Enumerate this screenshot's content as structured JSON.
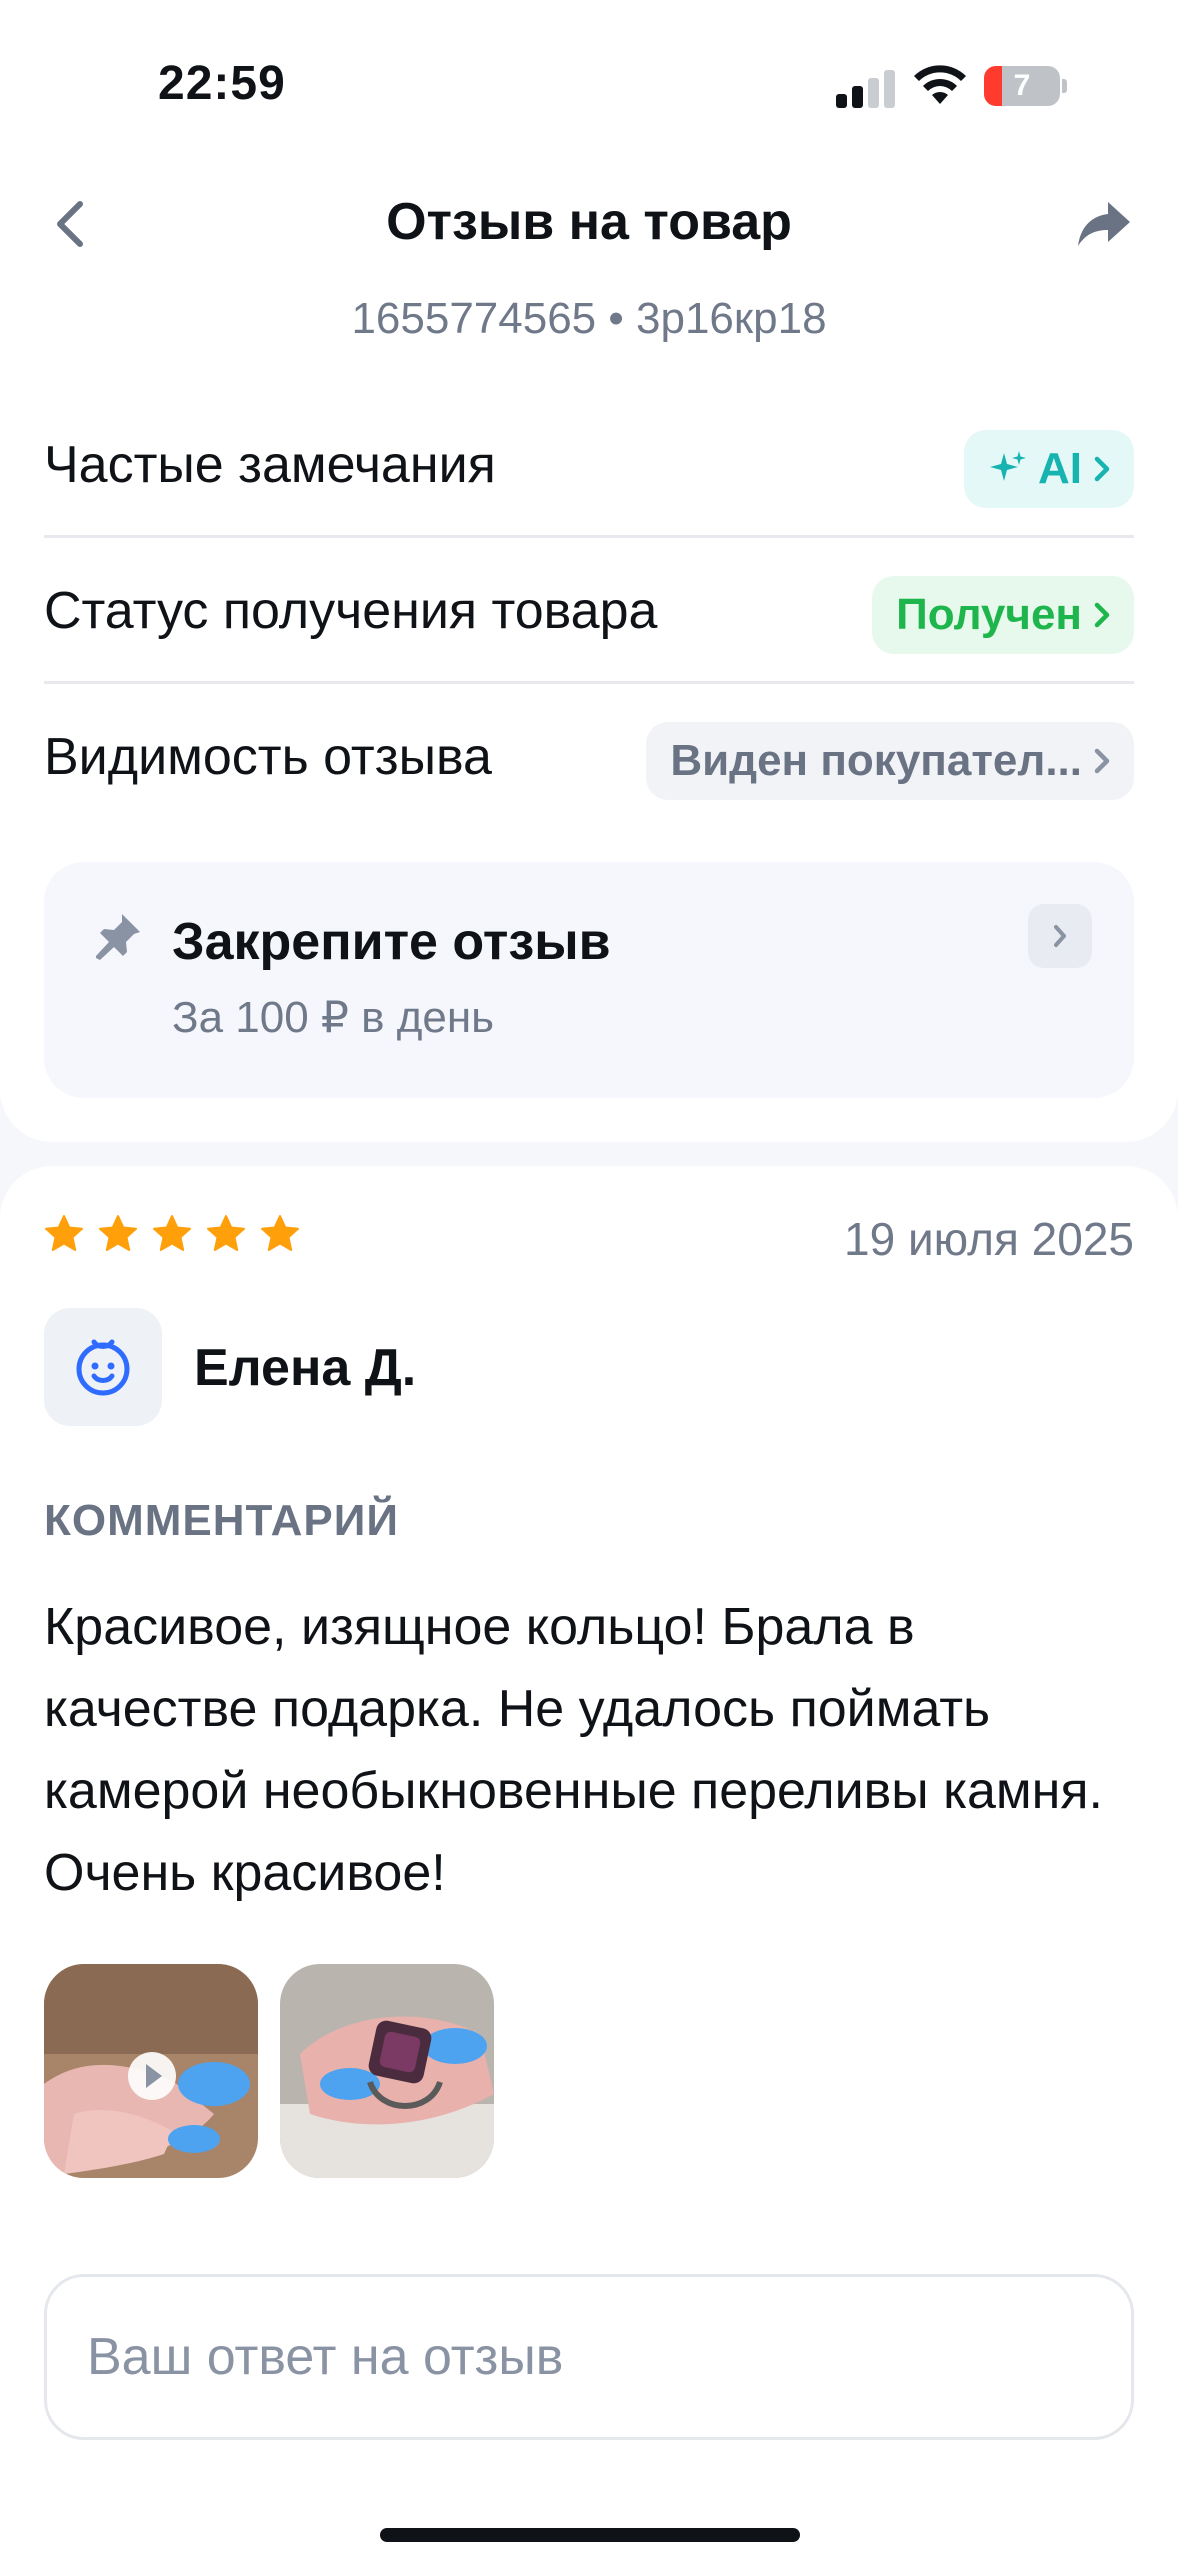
{
  "status_bar": {
    "time": "22:59",
    "battery": "7"
  },
  "header": {
    "title": "Отзыв на товар",
    "subtitle": "1655774565 • 3p16кр18"
  },
  "rows": {
    "frequent": {
      "label": "Частые замечания",
      "chip": "AI"
    },
    "receipt": {
      "label": "Статус получения товара",
      "chip": "Получен"
    },
    "visibility": {
      "label": "Видимость отзыва",
      "chip": "Виден покупател..."
    }
  },
  "pin": {
    "title": "Закрепите отзыв",
    "subtitle": "За 100 ₽ в день"
  },
  "review": {
    "rating": 5,
    "date": "19 июля 2025",
    "author": "Елена Д.",
    "comment_label": "КОММЕНТАРИЙ",
    "comment": "Красивое, изящное кольцо! Брала в качестве подарка. Не удалось поймать камерой необыкновенные переливы камня. Очень красивое!"
  },
  "reply": {
    "placeholder": "Ваш ответ на отзыв"
  },
  "colors": {
    "accent_teal": "#17b3b0",
    "status_green": "#1fb54d",
    "star_orange": "#ff9f0a",
    "avatar_blue": "#2f6bff"
  }
}
